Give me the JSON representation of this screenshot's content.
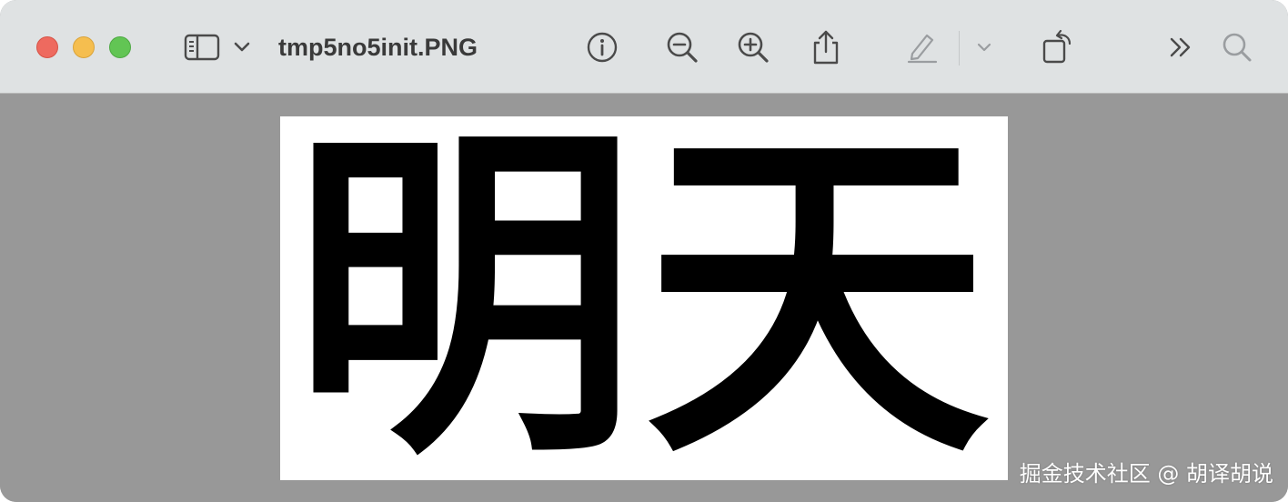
{
  "window": {
    "title": "tmp5no5init.PNG"
  },
  "toolbar": {
    "icons": [
      "sidebar-icon",
      "chevron-down-icon",
      "info-icon",
      "zoom-out-icon",
      "zoom-in-icon",
      "share-icon",
      "markup-pen-icon",
      "chevron-down-icon",
      "rotate-icon",
      "more-icon",
      "search-icon"
    ]
  },
  "document": {
    "text": "明天"
  },
  "watermark": {
    "text": "掘金技术社区 @ 胡译胡说"
  },
  "colors": {
    "close": "#ee6a5f",
    "minimize": "#f5be4f",
    "zoom": "#62c554",
    "toolbar_bg": "#dfe2e3",
    "content_bg": "#989898"
  }
}
